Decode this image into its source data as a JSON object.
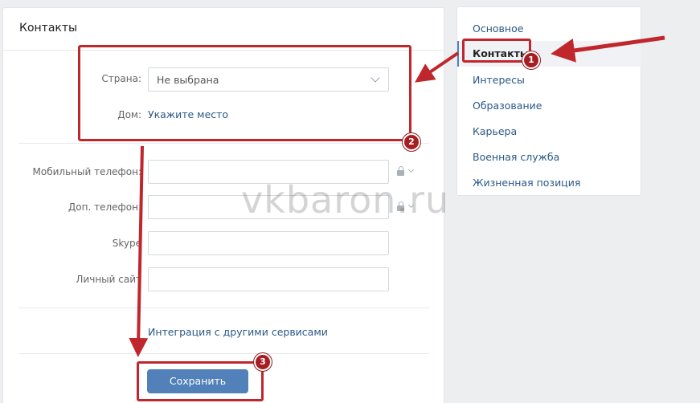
{
  "main": {
    "title": "Контакты",
    "country": {
      "label": "Страна:",
      "value": "Не выбрана"
    },
    "home": {
      "label": "Дом:",
      "link": "Укажите место"
    },
    "mobile": {
      "label": "Мобильный телефон:",
      "value": ""
    },
    "alt_phone": {
      "label": "Доп. телефон:",
      "value": ""
    },
    "skype": {
      "label": "Skype",
      "value": ""
    },
    "site": {
      "label": "Личный сайт",
      "value": ""
    },
    "integration_link": "Интеграция с другими сервисами",
    "save_label": "Сохранить"
  },
  "sidebar": {
    "items": [
      {
        "label": "Основное",
        "active": false
      },
      {
        "label": "Контакты",
        "active": true
      },
      {
        "label": "Интересы",
        "active": false
      },
      {
        "label": "Образование",
        "active": false
      },
      {
        "label": "Карьера",
        "active": false
      },
      {
        "label": "Военная служба",
        "active": false
      },
      {
        "label": "Жизненная позиция",
        "active": false
      }
    ]
  },
  "watermark": "vkbaron.ru",
  "annotations": {
    "badge_1": "1",
    "badge_2": "2",
    "badge_3": "3"
  },
  "colors": {
    "accent": "#5181b8",
    "link": "#2a5885",
    "annotation": "#c0272d"
  }
}
